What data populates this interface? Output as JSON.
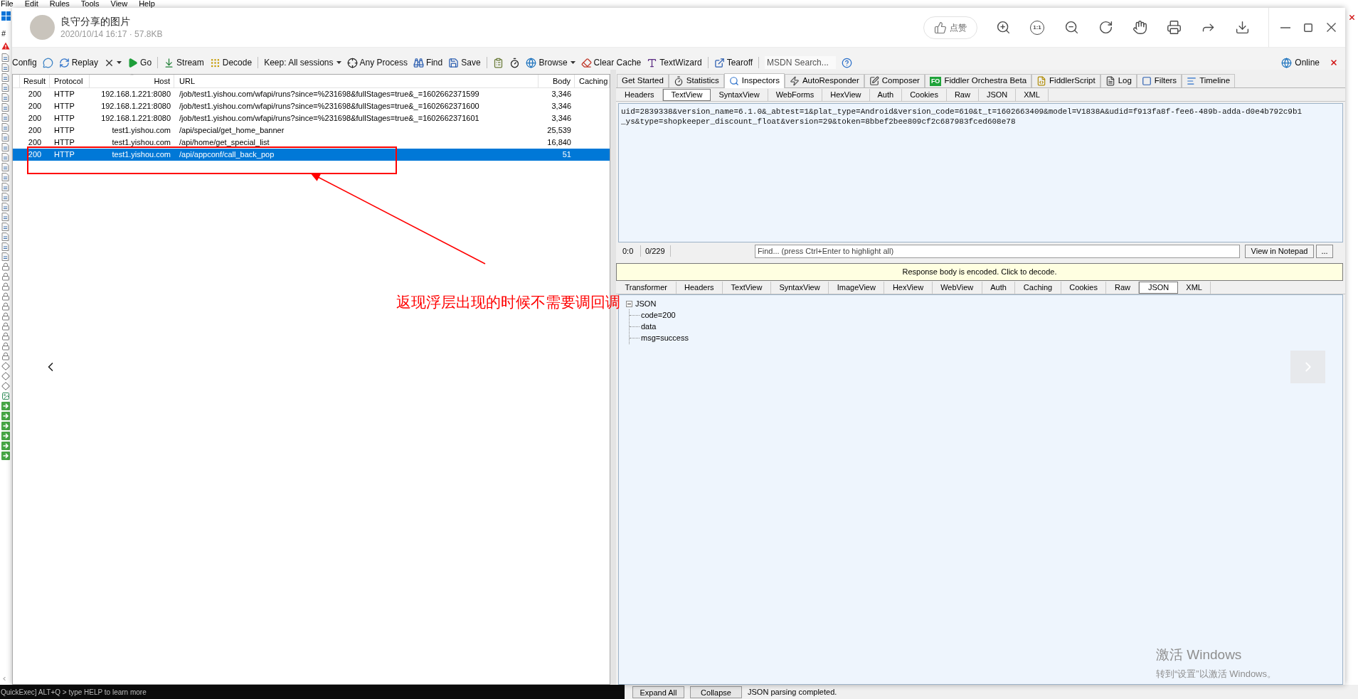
{
  "background_app": {
    "menu": [
      "File",
      "Edit",
      "Rules",
      "Tools",
      "View",
      "Help"
    ],
    "column_header": "#",
    "quickexec": "QuickExec] ALT+Q > type HELP to learn more",
    "bottom_buttons": [
      "Expand All",
      "Collapse"
    ],
    "bottom_status": "JSON parsing completed."
  },
  "viewer": {
    "title": "良守分享的图片",
    "meta": "2020/10/14 16:17 · 57.8KB",
    "like_label": "点赞",
    "actual_size_label": "1:1"
  },
  "image": {
    "toolbar": {
      "items": [
        {
          "kind": "text",
          "label": "Config"
        },
        {
          "kind": "icon"
        },
        {
          "kind": "text",
          "label": "Replay"
        },
        {
          "kind": "icon_menu"
        },
        {
          "kind": "text",
          "label": "Go"
        },
        {
          "kind": "separator"
        },
        {
          "kind": "text",
          "label": "Stream"
        },
        {
          "kind": "text",
          "label": "Decode"
        },
        {
          "kind": "separator"
        },
        {
          "kind": "menu",
          "label": "Keep: All sessions"
        },
        {
          "kind": "text",
          "label": "Any Process"
        },
        {
          "kind": "text",
          "label": "Find"
        },
        {
          "kind": "text",
          "label": "Save"
        },
        {
          "kind": "separator"
        },
        {
          "kind": "icon"
        },
        {
          "kind": "icon"
        },
        {
          "kind": "menu",
          "label": "Browse"
        },
        {
          "kind": "text",
          "label": "Clear Cache"
        },
        {
          "kind": "text",
          "label": "TextWizard"
        },
        {
          "kind": "separator"
        },
        {
          "kind": "text",
          "label": "Tearoff"
        },
        {
          "kind": "separator"
        },
        {
          "kind": "search",
          "placeholder": "MSDN Search..."
        },
        {
          "kind": "icon"
        }
      ],
      "online_label": "Online"
    },
    "sessions": {
      "columns": [
        "Result",
        "Protocol",
        "Host",
        "URL",
        "Body",
        "Caching"
      ],
      "rows": [
        {
          "result": "200",
          "protocol": "HTTP",
          "host": "192.168.1.221:8080",
          "url": "/job/test1.yishou.com/wfapi/runs?since=%231698&fullStages=true&_=1602662371599",
          "body": "3,346",
          "selected": false
        },
        {
          "result": "200",
          "protocol": "HTTP",
          "host": "192.168.1.221:8080",
          "url": "/job/test1.yishou.com/wfapi/runs?since=%231698&fullStages=true&_=1602662371600",
          "body": "3,346",
          "selected": false
        },
        {
          "result": "200",
          "protocol": "HTTP",
          "host": "192.168.1.221:8080",
          "url": "/job/test1.yishou.com/wfapi/runs?since=%231698&fullStages=true&_=1602662371601",
          "body": "3,346",
          "selected": false
        },
        {
          "result": "200",
          "protocol": "HTTP",
          "host": "test1.yishou.com",
          "url": "/api/special/get_home_banner",
          "body": "25,539",
          "selected": false
        },
        {
          "result": "200",
          "protocol": "HTTP",
          "host": "test1.yishou.com",
          "url": "/api/home/get_special_list",
          "body": "16,840",
          "selected": false
        },
        {
          "result": "200",
          "protocol": "HTTP",
          "host": "test1.yishou.com",
          "url": "/api/appconf/call_back_pop",
          "body": "51",
          "selected": true
        }
      ]
    },
    "inspector": {
      "tabs": [
        {
          "label": "Get Started",
          "selected": false
        },
        {
          "label": "Statistics",
          "selected": false
        },
        {
          "label": "Inspectors",
          "selected": true
        },
        {
          "label": "AutoResponder",
          "selected": false
        },
        {
          "label": "Composer",
          "selected": false
        },
        {
          "label": "Fiddler Orchestra Beta",
          "badge": "FO",
          "selected": false
        },
        {
          "label": "FiddlerScript",
          "selected": false
        },
        {
          "label": "Log",
          "selected": false
        },
        {
          "label": "Filters",
          "selected": false
        },
        {
          "label": "Timeline",
          "selected": false
        }
      ],
      "request_tabs": [
        {
          "label": "Headers",
          "selected": false
        },
        {
          "label": "TextView",
          "selected": true
        },
        {
          "label": "SyntaxView",
          "selected": false
        },
        {
          "label": "WebForms",
          "selected": false
        },
        {
          "label": "HexView",
          "selected": false
        },
        {
          "label": "Auth",
          "selected": false
        },
        {
          "label": "Cookies",
          "selected": false
        },
        {
          "label": "Raw",
          "selected": false
        },
        {
          "label": "JSON",
          "selected": false
        },
        {
          "label": "XML",
          "selected": false
        }
      ],
      "request_body_lines": [
        "uid=2839338&version_name=6.1.0&_abtest=1&plat_type=Android&version_code=610&t_t=1602663409&model=V1838A&udid=f913fa8f-fee6-489b-adda-d0e4b792c9b1",
        "_ys&type=shopkeeper_discount_float&version=29&token=8bbef2bee809cf2c687983fced608e78"
      ],
      "cursor_position": "0:0",
      "char_count": "0/229",
      "find_placeholder": "Find... (press Ctrl+Enter to highlight all)",
      "view_button": "View in Notepad",
      "more_button": "...",
      "encoded_banner": "Response body is encoded. Click to decode.",
      "response_tabs": [
        {
          "label": "Transformer",
          "selected": false
        },
        {
          "label": "Headers",
          "selected": false
        },
        {
          "label": "TextView",
          "selected": false
        },
        {
          "label": "SyntaxView",
          "selected": false
        },
        {
          "label": "ImageView",
          "selected": false
        },
        {
          "label": "HexView",
          "selected": false
        },
        {
          "label": "WebView",
          "selected": false
        },
        {
          "label": "Auth",
          "selected": false
        },
        {
          "label": "Caching",
          "selected": false
        },
        {
          "label": "Cookies",
          "selected": false
        },
        {
          "label": "Raw",
          "selected": false
        },
        {
          "label": "JSON",
          "selected": true
        },
        {
          "label": "XML",
          "selected": false
        }
      ],
      "json_tree": {
        "label": "JSON",
        "expanded": true,
        "children": [
          {
            "label": "code=200"
          },
          {
            "label": "data"
          },
          {
            "label": "msg=success"
          }
        ]
      }
    },
    "annotation": {
      "note": "返现浮层出现的时候不需要调回调"
    }
  },
  "os_watermark": {
    "title": "激活 Windows",
    "subtitle": "转到“设置”以激活 Windows。"
  }
}
